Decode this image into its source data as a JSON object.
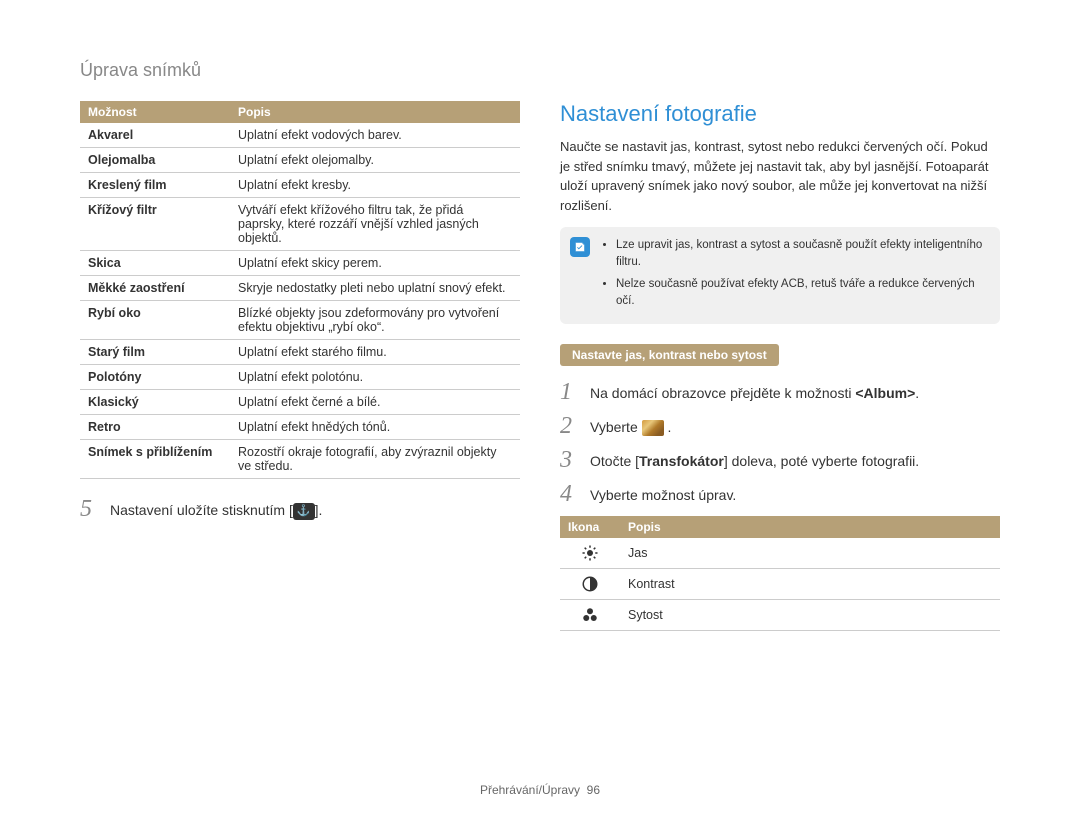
{
  "page_title": "Úprava snímků",
  "opts_table": {
    "headers": [
      "Možnost",
      "Popis"
    ],
    "rows": [
      [
        "Akvarel",
        "Uplatní efekt vodových barev."
      ],
      [
        "Olejomalba",
        "Uplatní efekt olejomalby."
      ],
      [
        "Kreslený film",
        "Uplatní efekt kresby."
      ],
      [
        "Křížový filtr",
        "Vytváří efekt křížového filtru tak, že přidá paprsky, které rozzáří vnější vzhled jasných objektů."
      ],
      [
        "Skica",
        "Uplatní efekt skicy perem."
      ],
      [
        "Měkké zaostření",
        "Skryje nedostatky pleti nebo uplatní snový efekt."
      ],
      [
        "Rybí oko",
        "Blízké objekty jsou zdeformovány pro vytvoření efektu objektivu „rybí oko“."
      ],
      [
        "Starý film",
        "Uplatní efekt starého filmu."
      ],
      [
        "Polotóny",
        "Uplatní efekt polotónu."
      ],
      [
        "Klasický",
        "Uplatní efekt černé a bílé."
      ],
      [
        "Retro",
        "Uplatní efekt hnědých tónů."
      ],
      [
        "Snímek s přiblížením",
        "Rozostří okraje fotografií, aby zvýraznil objekty ve středu."
      ]
    ]
  },
  "left_step": {
    "num": "5",
    "text_before": "Nastavení uložíte stisknutím [",
    "text_after": "]."
  },
  "section_head": "Nastavení fotografie",
  "description": "Naučte se nastavit jas, kontrast, sytost nebo redukci červených očí. Pokud je střed snímku tmavý, můžete jej nastavit tak, aby byl jasnější. Fotoaparát uloží upravený snímek jako nový soubor, ale může jej konvertovat na nižší rozlišení.",
  "notes": [
    "Lze upravit jas, kontrast a sytost a současně použít efekty inteligentního filtru.",
    "Nelze současně používat efekty ACB, retuš tváře a redukce červených očí."
  ],
  "pill": "Nastavte jas, kontrast nebo sytost",
  "steps": [
    {
      "num": "1",
      "html": "Na domácí obrazovce přejděte k možnosti <b>&lt;Album&gt;</b>."
    },
    {
      "num": "2",
      "html": "Vyberte <span class=\"thumb\" data-name=\"edit-icon\" data-interactable=\"false\"></span> ."
    },
    {
      "num": "3",
      "html": "Otočte [<b>Transfokátor</b>] doleva, poté vyberte fotografii."
    },
    {
      "num": "4",
      "html": "Vyberte možnost úprav."
    }
  ],
  "icons_table": {
    "headers": [
      "Ikona",
      "Popis"
    ],
    "rows": [
      {
        "icon": "brightness",
        "label": "Jas"
      },
      {
        "icon": "contrast",
        "label": "Kontrast"
      },
      {
        "icon": "saturation",
        "label": "Sytost"
      }
    ]
  },
  "footer": {
    "section": "Přehrávání/Úpravy",
    "page": "96"
  }
}
